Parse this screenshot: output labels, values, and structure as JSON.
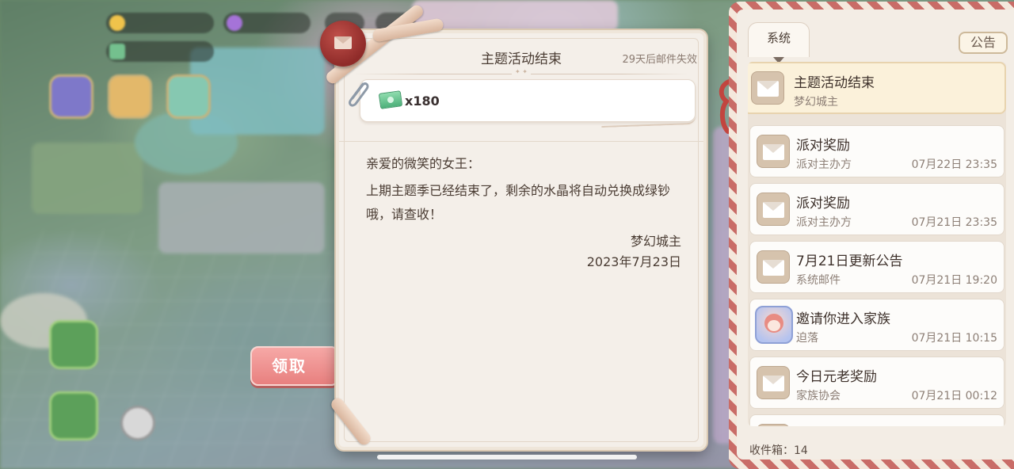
{
  "colors": {
    "claim_button": "#e8807f",
    "panel_bg": "#f4efe9",
    "selected_item_bg": "#fbf1da",
    "mailbox_stripe": "#c96c67"
  },
  "claim_button": {
    "label": "领取",
    "icon": "claim-button"
  },
  "mail_detail": {
    "title": "主题活动结束",
    "expire_notice": "29天后邮件失效",
    "attachment": {
      "icon": "cash-icon",
      "quantity": "x180"
    },
    "greeting": "亲爱的微笑的女王：",
    "content": "上期主题季已经结束了，剩余的水晶将自动兑换成绿钞哦，请查收！",
    "signature": "梦幻城主",
    "date": "2023年7月23日"
  },
  "mailbox": {
    "tab_label": "系统",
    "notice_button": "公告",
    "items": [
      {
        "title": "主题活动结束",
        "sender": "梦幻城主",
        "time": "",
        "icon": "envelope-icon",
        "selected": true
      },
      {
        "title": "派对奖励",
        "sender": "派对主办方",
        "time": "07月22日 23:35",
        "icon": "envelope-icon"
      },
      {
        "title": "派对奖励",
        "sender": "派对主办方",
        "time": "07月21日 23:35",
        "icon": "envelope-icon"
      },
      {
        "title": "7月21日更新公告",
        "sender": "系统邮件",
        "time": "07月21日 19:20",
        "icon": "envelope-icon"
      },
      {
        "title": "邀请你进入家族",
        "sender": "迫落",
        "time": "07月21日 10:15",
        "icon": "avatar-icon"
      },
      {
        "title": "今日元老奖励",
        "sender": "家族协会",
        "time": "07月21日 00:12",
        "icon": "envelope-icon"
      }
    ],
    "inbox_label": "收件箱：14"
  }
}
